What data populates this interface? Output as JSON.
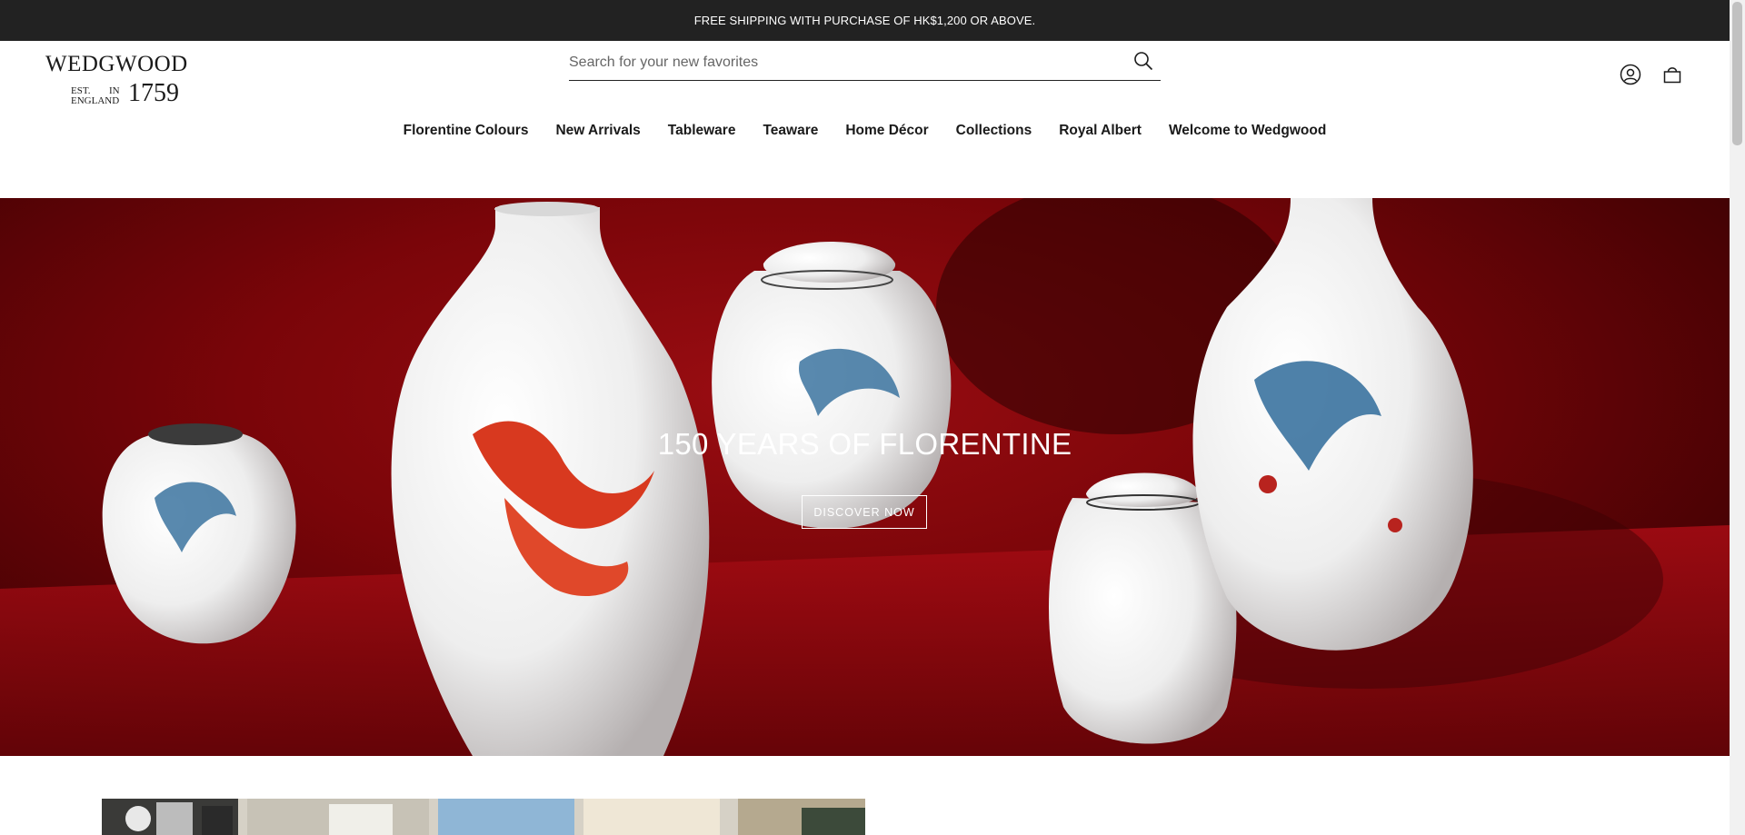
{
  "announcement": {
    "text": "FREE SHIPPING WITH PURCHASE OF HK$1,200 OR ABOVE."
  },
  "logo": {
    "word": "WEDGWOOD",
    "est": "EST.",
    "in": "IN",
    "england": "ENGLAND",
    "year": "1759"
  },
  "search": {
    "placeholder": "Search for your new favorites",
    "value": "",
    "icon": "search-icon"
  },
  "header_icons": {
    "account": "account-icon",
    "cart": "bag-icon"
  },
  "nav": {
    "items": [
      {
        "label": "Florentine Colours"
      },
      {
        "label": "New Arrivals"
      },
      {
        "label": "Tableware"
      },
      {
        "label": "Teaware"
      },
      {
        "label": "Home Décor"
      },
      {
        "label": "Collections"
      },
      {
        "label": "Royal Albert"
      },
      {
        "label": "Welcome to Wedgwood"
      }
    ]
  },
  "hero": {
    "title": "150 YEARS OF FLORENTINE",
    "button": "DISCOVER NOW",
    "background_color": "#7a0509"
  },
  "colors": {
    "announcement_bg": "#222222",
    "text": "#1a1a1a",
    "hero_red": "#9a0d12"
  }
}
